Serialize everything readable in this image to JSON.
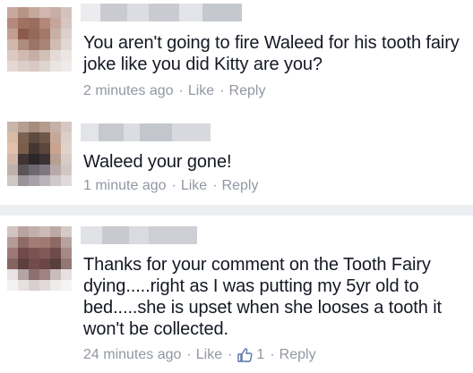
{
  "comments": [
    {
      "text": "You aren't going to fire Waleed for his tooth fairy joke like you did Kitty are you?",
      "time": "2 minutes ago",
      "like_label": "Like",
      "reply_label": "Reply",
      "separator": "·"
    },
    {
      "text": "Waleed your gone!",
      "time": "1 minute ago",
      "like_label": "Like",
      "reply_label": "Reply",
      "separator": "·"
    },
    {
      "text": "Thanks for your comment on the Tooth Fairy dying.....right as I was putting my 5yr old to bed.....she is upset when she looses a tooth it won't be collected.",
      "time": "24 minutes ago",
      "like_label": "Like",
      "like_count": "1",
      "reply_label": "Reply",
      "separator": "·",
      "like_icon": "thumbs-up-icon"
    }
  ],
  "colors": {
    "meta_text": "#9197a3",
    "body_text": "#141823",
    "like_icon": "#5b74a8",
    "background": "#e9eaee"
  }
}
